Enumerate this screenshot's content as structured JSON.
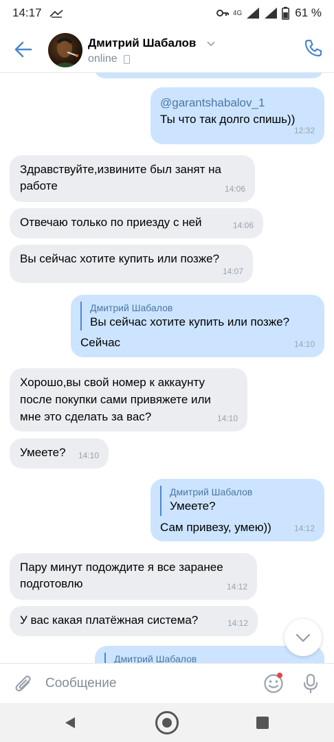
{
  "status_bar": {
    "time": "14:17",
    "signal_label": "4G",
    "battery": "61 %"
  },
  "header": {
    "contact_name": "Дмитрий Шабалов",
    "status": "online"
  },
  "messages": [
    {
      "id": "m1",
      "direction": "out",
      "mention": "@garantshabalov_1",
      "text": "Ты что так долго спишь))",
      "time": "12:32"
    },
    {
      "id": "m2",
      "direction": "in",
      "lines": [
        "Здравствуйте,извините был занят на",
        "работе"
      ],
      "time": "14:06"
    },
    {
      "id": "m3",
      "direction": "in",
      "text": "Отвечаю только по приезду с ней",
      "time": "14:06"
    },
    {
      "id": "m4",
      "direction": "in",
      "text": "Вы сейчас хотите купить или позже?",
      "time": "14:07"
    },
    {
      "id": "m5",
      "direction": "out",
      "quote_name": "Дмитрий Шабалов",
      "quote_text": "Вы сейчас хотите купить или позже?",
      "text": "Сейчас",
      "time": "14:10"
    },
    {
      "id": "m6",
      "direction": "in",
      "lines": [
        "Хорошо,вы свой номер к аккаунту",
        "после покупки сами привяжете или",
        "мне это сделать за вас?"
      ],
      "time": "14:10"
    },
    {
      "id": "m7",
      "direction": "in",
      "text": "Умеете?",
      "time": "14:10"
    },
    {
      "id": "m8",
      "direction": "out",
      "quote_name": "Дмитрий Шабалов",
      "quote_text": "Умеете?",
      "text": "Сам привезу, умею))",
      "time": "14:12"
    },
    {
      "id": "m9",
      "direction": "in",
      "lines": [
        "Пару минут подождите я все заранее",
        "подготовлю"
      ],
      "time": "14:12"
    },
    {
      "id": "m10",
      "direction": "in",
      "text": "У вас какая платёжная система?",
      "time": "14:12"
    },
    {
      "id": "m11",
      "direction": "out",
      "quote_name": "Дмитрий Шабалов"
    }
  ],
  "composer": {
    "placeholder": "Сообщение"
  },
  "icons": {
    "back": "arrow-left-icon",
    "call": "phone-icon",
    "attach": "paperclip-icon",
    "sticker": "smile-icon",
    "mic": "microphone-icon",
    "scroll": "chevron-down-icon"
  },
  "colors": {
    "accent": "#4986cc",
    "incoming_bubble": "#ebedf0",
    "outgoing_bubble": "#cce4ff",
    "link": "#4a76a8",
    "time": "#99a2ad",
    "unread_dot": "#e64646"
  }
}
